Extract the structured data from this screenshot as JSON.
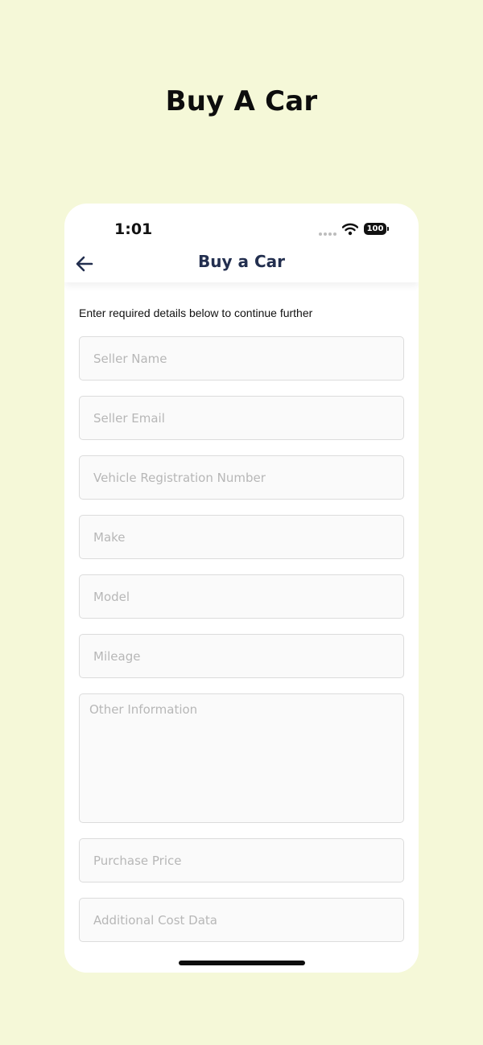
{
  "promo": {
    "title": "Buy A Car"
  },
  "status_bar": {
    "time": "1:01",
    "battery": "100",
    "icons": [
      "signal-dots-icon",
      "wifi-icon",
      "battery-icon"
    ]
  },
  "header": {
    "title": "Buy a Car",
    "back_icon": "back-arrow-icon"
  },
  "form": {
    "instruction": "Enter required details below to continue further",
    "fields": {
      "seller_name": {
        "placeholder": "Seller Name",
        "value": ""
      },
      "seller_email": {
        "placeholder": "Seller Email",
        "value": ""
      },
      "vehicle_registration": {
        "placeholder": "Vehicle Registration Number",
        "value": ""
      },
      "make": {
        "placeholder": "Make",
        "value": ""
      },
      "model": {
        "placeholder": "Model",
        "value": ""
      },
      "mileage": {
        "placeholder": "Mileage",
        "value": ""
      },
      "other_information": {
        "placeholder": "Other Information",
        "value": ""
      },
      "purchase_price": {
        "placeholder": "Purchase Price",
        "value": ""
      },
      "additional_cost": {
        "placeholder": "Additional Cost Data",
        "value": ""
      }
    }
  },
  "colors": {
    "page_background": "#f5f8d8",
    "header_text": "#232f4f",
    "field_background": "#fafafa",
    "field_border": "#dcdcdc",
    "placeholder": "#b7b7b7"
  }
}
